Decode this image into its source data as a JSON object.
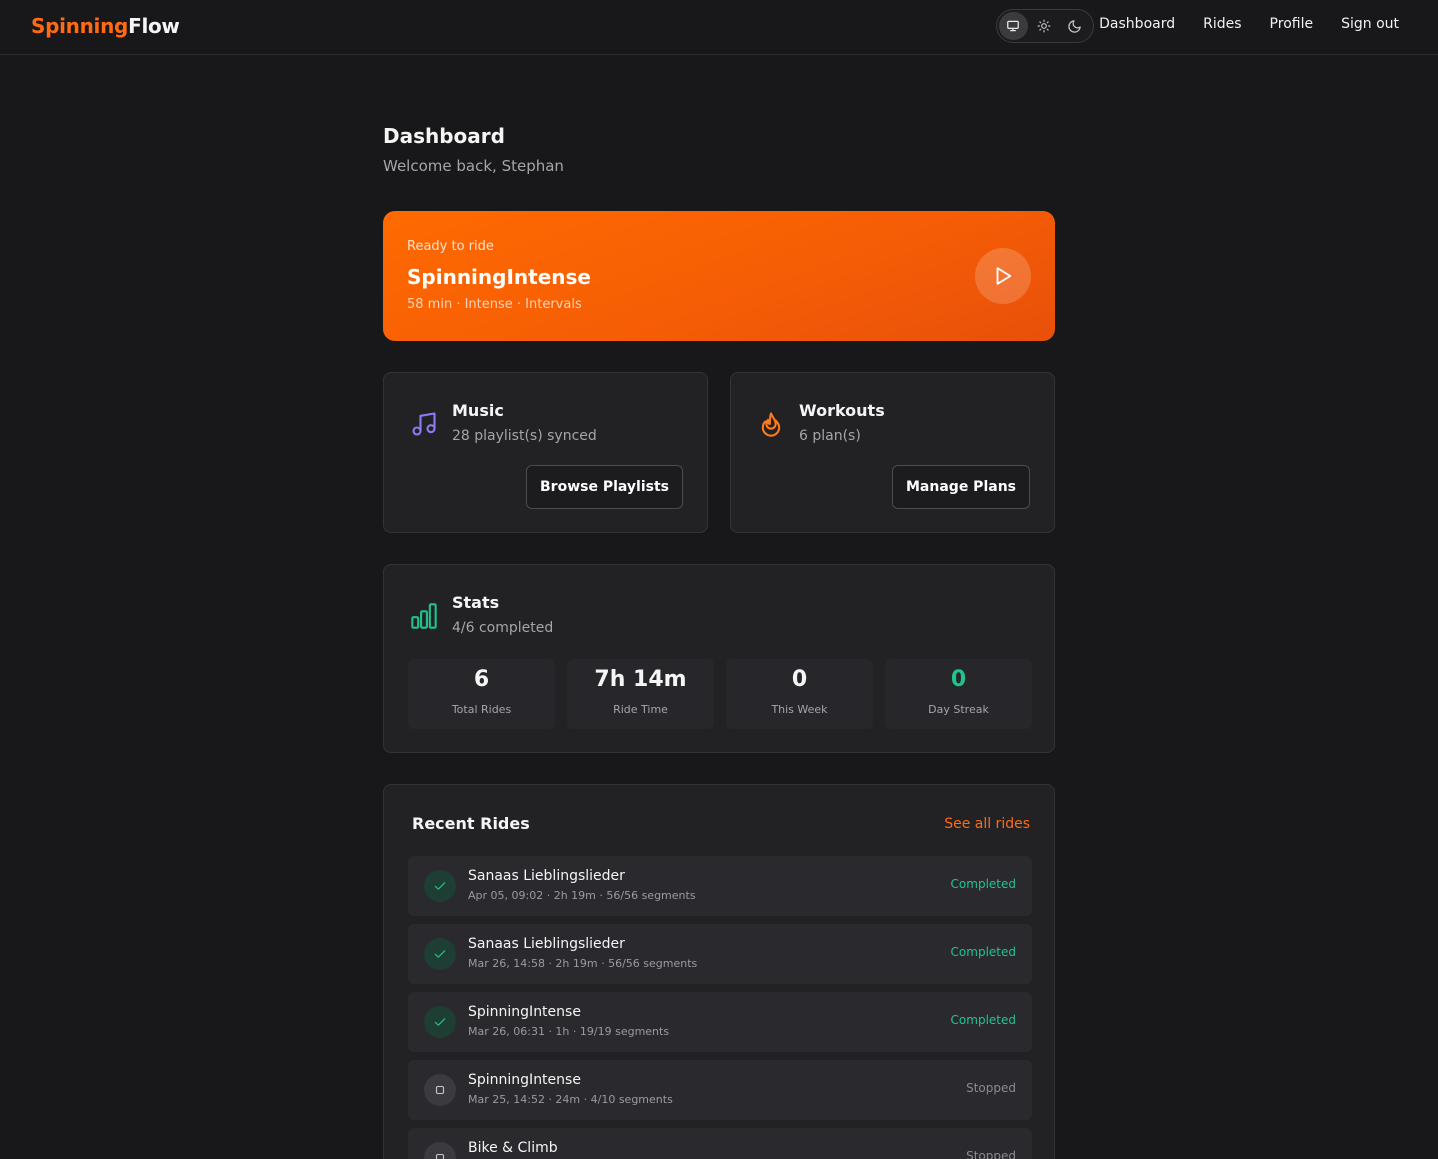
{
  "app": {
    "logo_part1": "Spinning",
    "logo_part2": "Flow"
  },
  "nav": {
    "items": [
      "Dashboard",
      "Rides",
      "Profile",
      "Sign out"
    ]
  },
  "theme": {
    "options": [
      "monitor-icon",
      "sun-icon",
      "moon-icon"
    ],
    "active": "monitor-icon"
  },
  "header": {
    "title": "Dashboard",
    "subtitle": "Welcome back, Stephan"
  },
  "hero": {
    "label": "Ready to ride",
    "title": "SpinningIntense",
    "meta": "58 min · Intense · Intervals",
    "color": "#ff6a00"
  },
  "music": {
    "title": "Music",
    "subtitle": "28 playlist(s) synced",
    "button": "Browse Playlists",
    "icon": "music-note-icon",
    "icon_color": "#8b7cf6"
  },
  "workouts": {
    "title": "Workouts",
    "subtitle": "6 plan(s)",
    "button": "Manage Plans",
    "icon": "flame-icon",
    "icon_color": "#ff7a1a"
  },
  "stats": {
    "title": "Stats",
    "subtitle": "4/6 completed",
    "icon": "bar-chart-icon",
    "icon_color": "#1fc48d",
    "items": [
      {
        "value": "6",
        "label": "Total Rides"
      },
      {
        "value": "7h 14m",
        "label": "Ride Time"
      },
      {
        "value": "0",
        "label": "This Week"
      },
      {
        "value": "0",
        "label": "Day Streak"
      }
    ]
  },
  "recent": {
    "title": "Recent Rides",
    "see_all": "See all rides",
    "rides": [
      {
        "name": "Sanaas Lieblingslieder",
        "meta": "Apr 05, 09:02 · 2h 19m · 56/56 segments",
        "status": "Completed"
      },
      {
        "name": "Sanaas Lieblingslieder",
        "meta": "Mar 26, 14:58 · 2h 19m · 56/56 segments",
        "status": "Completed"
      },
      {
        "name": "SpinningIntense",
        "meta": "Mar 26, 06:31 · 1h · 19/19 segments",
        "status": "Completed"
      },
      {
        "name": "SpinningIntense",
        "meta": "Mar 25, 14:52 · 24m · 4/10 segments",
        "status": "Stopped"
      },
      {
        "name": "Bike & Climb",
        "meta": "",
        "status": "Stopped"
      }
    ]
  },
  "colors": {
    "accent": "#ff6a13",
    "success": "#1fc48d",
    "background": "#18181a",
    "card": "#222225"
  }
}
